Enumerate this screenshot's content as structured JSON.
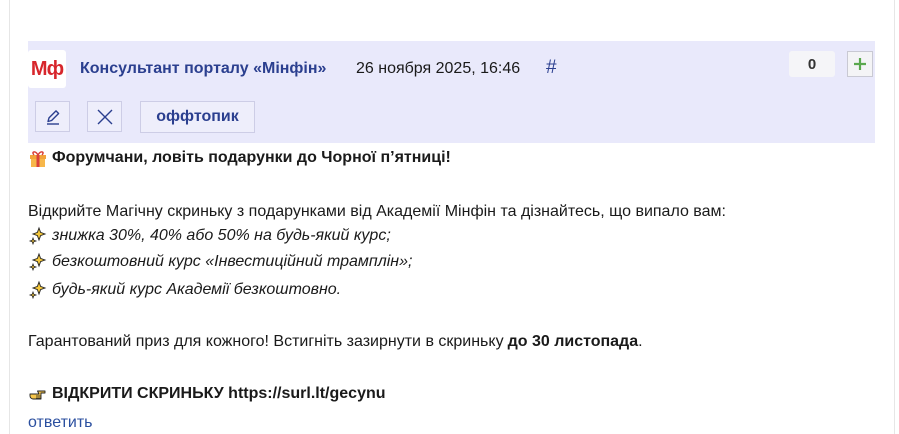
{
  "post": {
    "logo_text": "Мф",
    "author": "Консультант порталу «Мінфін»",
    "date": "26 ноября 2025, 16:46",
    "permalink": "#",
    "score": "0",
    "tag": "оффтопик",
    "icons": {
      "vote": "plus-icon",
      "edit": "pencil-icon",
      "delete": "close-icon",
      "gift": "gift-icon",
      "sparkle": "sparkles-icon",
      "pointer": "pointing-hand-icon"
    },
    "colors": {
      "header_bg": "#e9e9fb",
      "link": "#2b3f8f",
      "logo_red": "#d7262c",
      "plus_green": "#5aa84e"
    }
  },
  "body": {
    "headline": "Форумчани, ловіть подарунки до Чорної п’ятниці!",
    "intro": "Відкрийте Магічну скриньку з подарунками від Академії Мінфін та дізнайтесь, що випало вам:",
    "items": [
      "знижка 30%, 40% або 50% на будь-який курс;",
      "безкоштовний курс «Інвестиційний трамплін»;",
      "будь-який курс Академії безкоштовно."
    ],
    "guarantee_text": "Гарантований приз для кожного! Встигніть зазирнути в скриньку ",
    "guarantee_bold": "до 30 листопада",
    "guarantee_end": ".",
    "cta": "ВІДКРИТИ СКРИНЬКУ https://surl.lt/gecynu"
  },
  "actions": {
    "reply": "ответить"
  }
}
